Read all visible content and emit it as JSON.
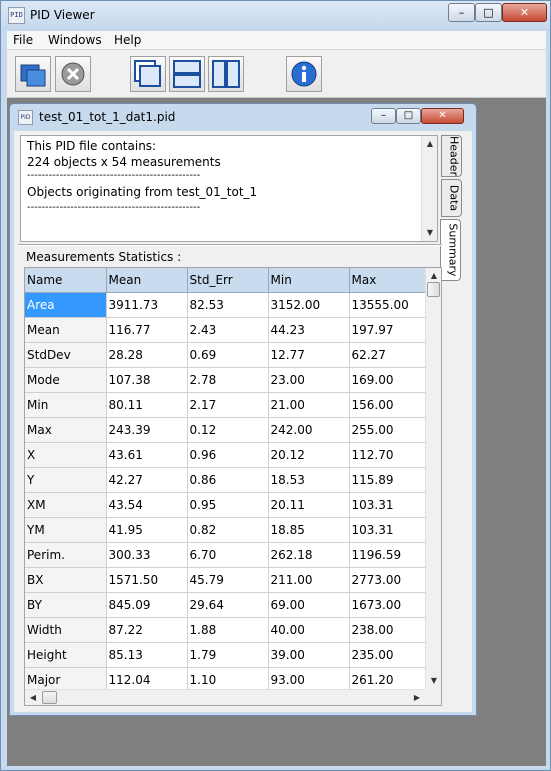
{
  "app": {
    "title": "PID Viewer",
    "icon_text": "PID"
  },
  "caption_buttons": {
    "minimize": "–",
    "maximize": "□",
    "close": "✕"
  },
  "menu": [
    "File",
    "Windows",
    "Help"
  ],
  "toolbar": {
    "buttons": [
      "open-file-icon",
      "close-file-icon",
      "cascade-windows-icon",
      "tile-horizontal-icon",
      "tile-vertical-icon",
      "about-info-icon"
    ]
  },
  "child": {
    "title": "test_01_tot_1_dat1.pid",
    "icon_text": "PID",
    "info_lines": [
      "This PID file contains:",
      "224 objects x 54 measurements",
      "------------------------------------------------",
      "Objects originating from test_01_tot_1",
      "------------------------------------------------"
    ],
    "tabs": [
      "Header",
      "Data",
      "Summary"
    ],
    "active_tab": "Summary",
    "stats_label": "Measurements Statistics :",
    "table": {
      "columns": [
        "Name",
        "Mean",
        "Std_Err",
        "Min",
        "Max"
      ],
      "selected_row": "Area",
      "rows": [
        [
          "Area",
          "3911.73",
          "82.53",
          "3152.00",
          "13555.00"
        ],
        [
          "Mean",
          "116.77",
          "2.43",
          "44.23",
          "197.97"
        ],
        [
          "StdDev",
          "28.28",
          "0.69",
          "12.77",
          "62.27"
        ],
        [
          "Mode",
          "107.38",
          "2.78",
          "23.00",
          "169.00"
        ],
        [
          "Min",
          "80.11",
          "2.17",
          "21.00",
          "156.00"
        ],
        [
          "Max",
          "243.39",
          "0.12",
          "242.00",
          "255.00"
        ],
        [
          "X",
          "43.61",
          "0.96",
          "20.12",
          "112.70"
        ],
        [
          "Y",
          "42.27",
          "0.86",
          "18.53",
          "115.89"
        ],
        [
          "XM",
          "43.54",
          "0.95",
          "20.11",
          "103.31"
        ],
        [
          "YM",
          "41.95",
          "0.82",
          "18.85",
          "103.31"
        ],
        [
          "Perim.",
          "300.33",
          "6.70",
          "262.18",
          "1196.59"
        ],
        [
          "BX",
          "1571.50",
          "45.79",
          "211.00",
          "2773.00"
        ],
        [
          "BY",
          "845.09",
          "29.64",
          "69.00",
          "1673.00"
        ],
        [
          "Width",
          "87.22",
          "1.88",
          "40.00",
          "238.00"
        ],
        [
          "Height",
          "85.13",
          "1.79",
          "39.00",
          "235.00"
        ],
        [
          "Major",
          "112.04",
          "1.10",
          "93.00",
          "261.20"
        ]
      ]
    }
  },
  "colors": {
    "frame": "#c6d9ed",
    "header_cell": "#c8dbef",
    "selection": "#3399ff",
    "mdi_background": "#7f7f7f",
    "close_button": "#c74a34"
  }
}
